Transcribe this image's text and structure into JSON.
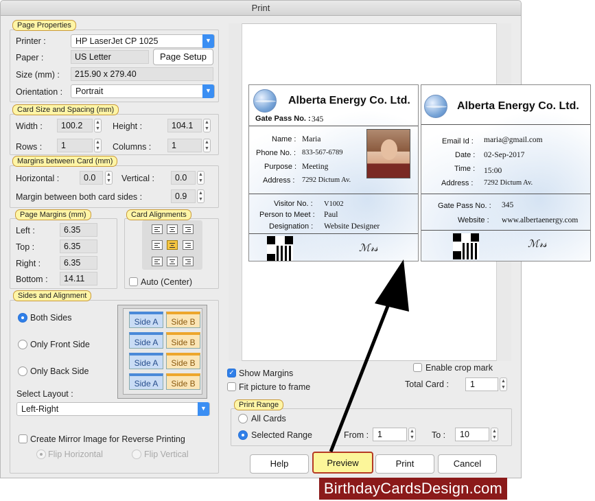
{
  "window_title": "Print",
  "page_properties": {
    "title": "Page Properties",
    "printer_label": "Printer :",
    "printer_value": "HP LaserJet CP 1025",
    "paper_label": "Paper :",
    "paper_value": "US Letter",
    "page_setup_label": "Page Setup",
    "size_label": "Size (mm) :",
    "size_value": "215.90 x 279.40",
    "orientation_label": "Orientation :",
    "orientation_value": "Portrait"
  },
  "card_size": {
    "title": "Card Size and Spacing (mm)",
    "width_label": "Width :",
    "width_value": "100.2",
    "height_label": "Height :",
    "height_value": "104.1",
    "rows_label": "Rows :",
    "rows_value": "1",
    "columns_label": "Columns :",
    "columns_value": "1"
  },
  "margins_between": {
    "title": "Margins between Card (mm)",
    "horizontal_label": "Horizontal :",
    "horizontal_value": "0.0",
    "vertical_label": "Vertical :",
    "vertical_value": "0.0",
    "both_sides_label": "Margin between both card sides :",
    "both_sides_value": "0.9"
  },
  "page_margins": {
    "title": "Page Margins (mm)",
    "left_label": "Left :",
    "left_value": "6.35",
    "top_label": "Top :",
    "top_value": "6.35",
    "right_label": "Right :",
    "right_value": "6.35",
    "bottom_label": "Bottom :",
    "bottom_value": "14.11"
  },
  "card_alignments": {
    "title": "Card Alignments",
    "auto_center_label": "Auto (Center)"
  },
  "sides": {
    "title": "Sides and Alignment",
    "both_sides": "Both Sides",
    "only_front": "Only Front Side",
    "only_back": "Only Back Side",
    "side_a": "Side A",
    "side_b": "Side B",
    "select_layout_label": "Select Layout :",
    "layout_value": "Left-Right",
    "mirror_label": "Create Mirror Image for Reverse Printing",
    "flip_horizontal": "Flip Horizontal",
    "flip_vertical": "Flip Vertical"
  },
  "preview_card_front": {
    "company": "Alberta Energy Co. Ltd.",
    "gate_pass_label": "Gate Pass No. :",
    "gate_pass_value": "345",
    "name_label": "Name :",
    "name_value": "Maria",
    "phone_label": "Phone No. :",
    "phone_value": "833-567-6789",
    "purpose_label": "Purpose :",
    "purpose_value": "Meeting",
    "address_label": "Address :",
    "address_value": "7292 Dictum Av.",
    "visitor_label": "Visitor No. :",
    "visitor_value": "V1002",
    "person_label": "Person to Meet :",
    "person_value": "Paul",
    "designation_label": "Designation :",
    "designation_value": "Website Designer"
  },
  "preview_card_back": {
    "company": "Alberta Energy Co. Ltd.",
    "email_label": "Email Id :",
    "email_value": "maria@gmail.com",
    "date_label": "Date :",
    "date_value": "02-Sep-2017",
    "time_label": "Time :",
    "time_value": "15:00",
    "address_label": "Address :",
    "address_value": "7292 Dictum Av.",
    "gate_pass_label": "Gate Pass No. :",
    "gate_pass_value": "345",
    "website_label": "Website :",
    "website_value": "www.albertaenergy.com"
  },
  "options": {
    "show_margins": "Show Margins",
    "fit_picture": "Fit picture to frame",
    "enable_crop": "Enable crop mark",
    "total_card_label": "Total Card :",
    "total_card_value": "1"
  },
  "print_range": {
    "title": "Print Range",
    "all_cards": "All Cards",
    "selected_range": "Selected Range",
    "from_label": "From :",
    "from_value": "1",
    "to_label": "To :",
    "to_value": "10"
  },
  "buttons": {
    "help": "Help",
    "preview": "Preview",
    "print": "Print",
    "cancel": "Cancel"
  },
  "watermark": "BirthdayCardsDesign.com",
  "colors": {
    "accent": "#2f7fe8",
    "highlight": "#fef5a6",
    "watermark_bg": "#8b1a1a"
  }
}
